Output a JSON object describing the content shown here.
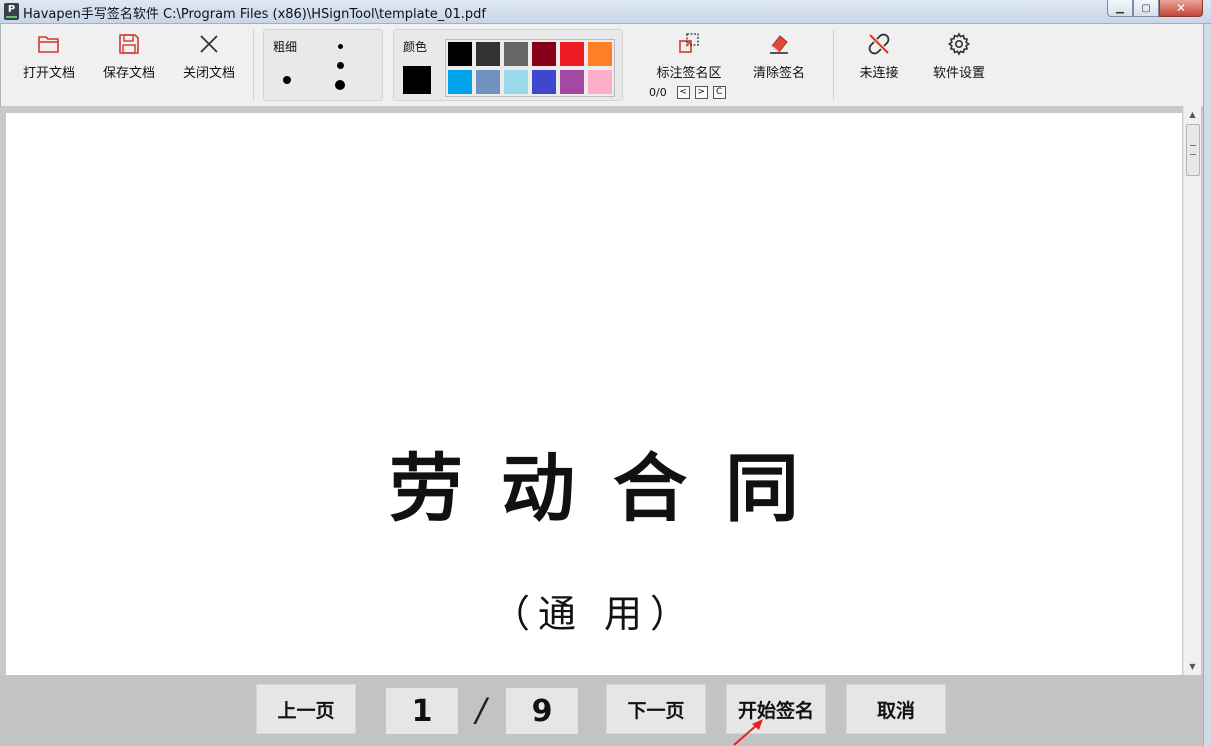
{
  "window": {
    "title": "Havapen手写签名软件  C:\\Program Files (x86)\\HSignTool\\template_01.pdf",
    "app_icon": "P"
  },
  "toolbar": {
    "open_label": "打开文档",
    "save_label": "保存文档",
    "close_label": "关闭文档",
    "thickness_label": "粗细",
    "color_label": "颜色",
    "current_color": "#000000",
    "swatches": [
      "#000000",
      "#333333",
      "#666666",
      "#880015",
      "#ed1c24",
      "#ff7f27",
      "#00a2e8",
      "#7092be",
      "#99d9ea",
      "#3f48cc",
      "#a349a4",
      "#ffaec9"
    ],
    "mark_area_label": "标注签名区",
    "clear_sign_label": "清除签名",
    "mark_counter": "0/0",
    "prev_mark": "<",
    "next_mark": ">",
    "clear_mark": "C",
    "connection_label": "未连接",
    "settings_label": "软件设置"
  },
  "document": {
    "title": "劳动合同",
    "subtitle": "（通 用）"
  },
  "bottom": {
    "prev_page": "上一页",
    "current_page": "1",
    "separator": "/",
    "total_pages": "9",
    "next_page": "下一页",
    "start_sign": "开始签名",
    "cancel": "取消"
  },
  "icons": {
    "open": "folder-icon",
    "save": "floppy-icon",
    "close": "close-icon",
    "mark": "mark-area-icon",
    "clear": "eraser-icon",
    "connection": "broken-link-icon",
    "settings": "gear-icon"
  }
}
